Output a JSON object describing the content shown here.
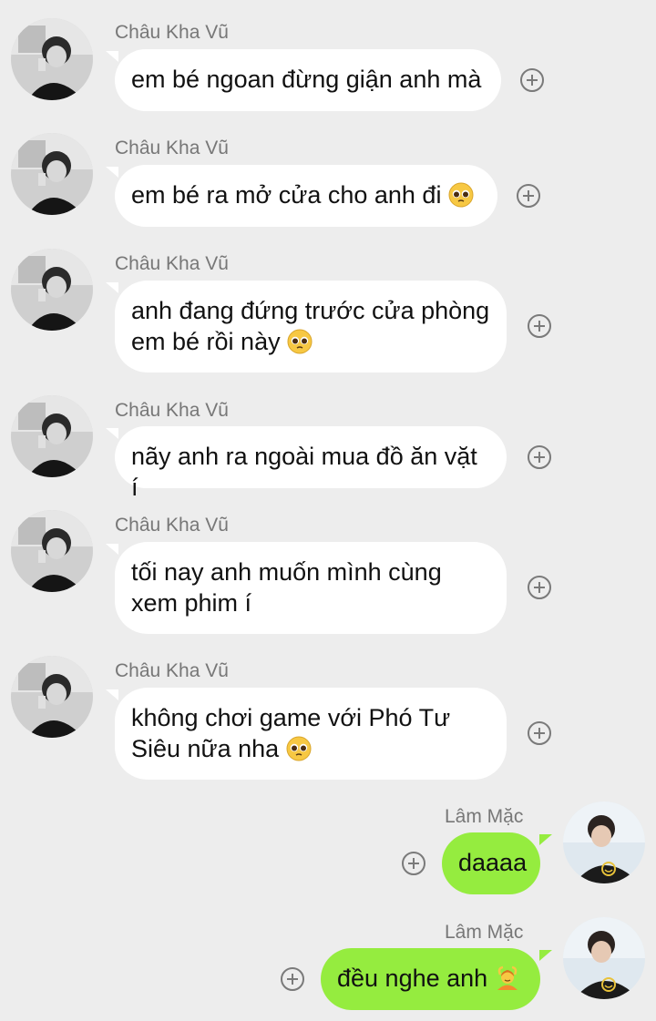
{
  "contacts": {
    "incoming_name": "Châu Kha Vũ",
    "outgoing_name": "Lâm Mặc"
  },
  "messages": [
    {
      "sender": "Châu Kha Vũ",
      "text": "em bé ngoan đừng giận anh mà",
      "emoji": ""
    },
    {
      "sender": "Châu Kha Vũ",
      "text": "em bé ra mở cửa cho anh đi",
      "emoji": "pleading-face"
    },
    {
      "sender": "Châu Kha Vũ",
      "text_line1": "anh đang đứng trước cửa phòng",
      "text_line2": "em bé rồi này",
      "emoji": "pleading-face"
    },
    {
      "sender": "Châu Kha Vũ",
      "text": "nãy anh ra ngoài mua đồ ăn vặt í",
      "emoji": ""
    },
    {
      "sender": "Châu Kha Vũ",
      "text_line1": "tối nay anh muốn mình cùng",
      "text_line2": "xem phim í",
      "emoji": ""
    },
    {
      "sender": "Châu Kha Vũ",
      "text_line1": "không chơi game với Phó Tư",
      "text_line2": "Siêu nữa nha",
      "emoji": "pleading-face"
    },
    {
      "sender": "Lâm Mặc",
      "text": "daaaa",
      "emoji": ""
    },
    {
      "sender": "Lâm Mặc",
      "text": "đều nghe anh",
      "emoji": "person-gesturing-ok"
    }
  ],
  "colors": {
    "background": "#ededed",
    "incoming_bubble": "#ffffff",
    "outgoing_bubble": "#95ec3f",
    "sender_text": "#777777"
  },
  "icons": {
    "add_button": "plus-circle-icon"
  }
}
